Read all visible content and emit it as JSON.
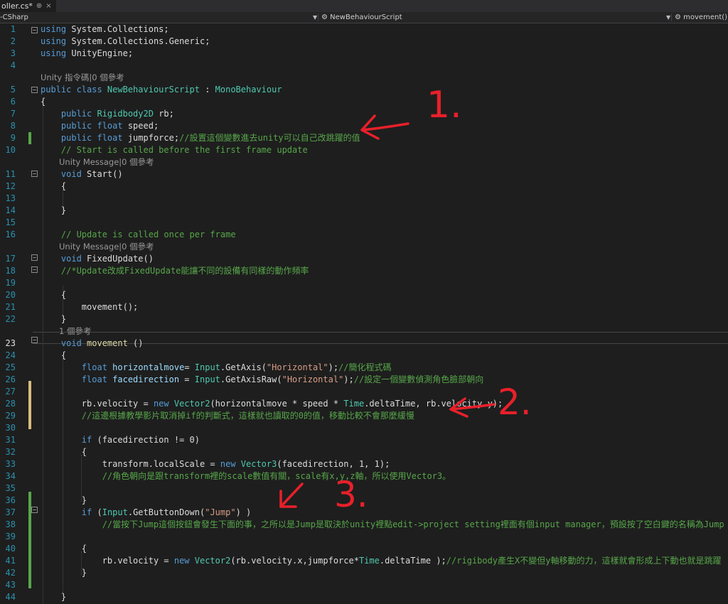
{
  "tab": {
    "label": "oller.cs*",
    "pin": "⊕",
    "close": "×"
  },
  "nav": {
    "project": "-CSharp",
    "class_icon": "⚙",
    "class": "NewBehaviourScript",
    "member_icon": "⚙",
    "member": "movement()"
  },
  "colors": {
    "background": "#1e1e1e",
    "keyword": "#569cd6",
    "type": "#4ec9b0",
    "comment": "#57a64a",
    "string": "#d69d85",
    "line_number": "#2b91af",
    "change_saved": "#57a64a",
    "change_unsaved": "#d7ba7d",
    "annotation": "#e8202a"
  },
  "lines": [
    {
      "n": "1",
      "parts": [
        {
          "c": "kw",
          "t": "using "
        },
        {
          "c": "",
          "t": "System.Collections;"
        }
      ]
    },
    {
      "n": "2",
      "parts": [
        {
          "c": "kw",
          "t": "using "
        },
        {
          "c": "",
          "t": "System.Collections.Generic;"
        }
      ]
    },
    {
      "n": "3",
      "parts": [
        {
          "c": "kw",
          "t": "using "
        },
        {
          "c": "",
          "t": "UnityEngine;"
        }
      ]
    },
    {
      "n": "4",
      "parts": []
    },
    {
      "lens": "Unity 指令碼|0 個參考"
    },
    {
      "n": "5",
      "parts": [
        {
          "c": "kw",
          "t": "public class "
        },
        {
          "c": "ty",
          "t": "NewBehaviourScript"
        },
        {
          "c": "",
          "t": " : "
        },
        {
          "c": "ty",
          "t": "MonoBehaviour"
        }
      ]
    },
    {
      "n": "6",
      "parts": [
        {
          "c": "",
          "t": "{"
        }
      ]
    },
    {
      "n": "7",
      "parts": [
        {
          "c": "",
          "t": "    "
        },
        {
          "c": "kw",
          "t": "public "
        },
        {
          "c": "ty",
          "t": "Rigidbody2D"
        },
        {
          "c": "",
          "t": " rb;"
        }
      ]
    },
    {
      "n": "8",
      "parts": [
        {
          "c": "",
          "t": "    "
        },
        {
          "c": "kw",
          "t": "public float "
        },
        {
          "c": "",
          "t": "speed;"
        }
      ]
    },
    {
      "n": "9",
      "parts": [
        {
          "c": "",
          "t": "    "
        },
        {
          "c": "kw",
          "t": "public float "
        },
        {
          "c": "",
          "t": "jumpforce;"
        },
        {
          "c": "cm",
          "t": "//設置這個變數進去unity可以自己改跳躍的值"
        }
      ]
    },
    {
      "n": "10",
      "parts": [
        {
          "c": "",
          "t": "    "
        },
        {
          "c": "cm",
          "t": "// Start is called before the first frame update"
        }
      ]
    },
    {
      "lens": "Unity Message|0 個參考"
    },
    {
      "n": "11",
      "parts": [
        {
          "c": "",
          "t": "    "
        },
        {
          "c": "kw",
          "t": "void "
        },
        {
          "c": "",
          "t": "Start()"
        }
      ]
    },
    {
      "n": "12",
      "parts": [
        {
          "c": "",
          "t": "    {"
        }
      ]
    },
    {
      "n": "13",
      "parts": []
    },
    {
      "n": "14",
      "parts": [
        {
          "c": "",
          "t": "    }"
        }
      ]
    },
    {
      "n": "15",
      "parts": []
    },
    {
      "n": "16",
      "parts": [
        {
          "c": "",
          "t": "    "
        },
        {
          "c": "cm",
          "t": "// Update is called once per frame"
        }
      ]
    },
    {
      "lens": "Unity Message|0 個參考"
    },
    {
      "n": "17",
      "parts": [
        {
          "c": "",
          "t": "    "
        },
        {
          "c": "kw",
          "t": "void "
        },
        {
          "c": "",
          "t": "FixedUpdate()"
        }
      ]
    },
    {
      "n": "18",
      "parts": [
        {
          "c": "",
          "t": "    "
        },
        {
          "c": "cm",
          "t": "//*Update改成FixedUpdate能讓不同的設備有同樣的動作頻率"
        }
      ]
    },
    {
      "n": "19",
      "parts": []
    },
    {
      "n": "20",
      "parts": [
        {
          "c": "",
          "t": "    {"
        }
      ]
    },
    {
      "n": "21",
      "parts": [
        {
          "c": "",
          "t": "        movement();"
        }
      ]
    },
    {
      "n": "22",
      "parts": [
        {
          "c": "",
          "t": "    }"
        }
      ]
    },
    {
      "lens": "1 個參考"
    },
    {
      "n": "23",
      "parts": [
        {
          "c": "",
          "t": "    "
        },
        {
          "c": "kw",
          "t": "void "
        },
        {
          "c": "fn",
          "t": "movement"
        },
        {
          "c": "",
          "t": " ()"
        }
      ]
    },
    {
      "n": "24",
      "parts": [
        {
          "c": "",
          "t": "    {"
        }
      ]
    },
    {
      "n": "25",
      "parts": [
        {
          "c": "",
          "t": "        "
        },
        {
          "c": "kw",
          "t": "float "
        },
        {
          "c": "id",
          "t": "horizontalmove"
        },
        {
          "c": "",
          "t": "= "
        },
        {
          "c": "ty",
          "t": "Input"
        },
        {
          "c": "",
          "t": ".GetAxis("
        },
        {
          "c": "st",
          "t": "\"Horizontal\""
        },
        {
          "c": "",
          "t": ");"
        },
        {
          "c": "cm",
          "t": "//簡化程式碼"
        }
      ]
    },
    {
      "n": "26",
      "parts": [
        {
          "c": "",
          "t": "        "
        },
        {
          "c": "kw",
          "t": "float "
        },
        {
          "c": "id",
          "t": "facedirection"
        },
        {
          "c": "",
          "t": " = "
        },
        {
          "c": "ty",
          "t": "Input"
        },
        {
          "c": "",
          "t": ".GetAxisRaw("
        },
        {
          "c": "st",
          "t": "\"Horizontal\""
        },
        {
          "c": "",
          "t": ");"
        },
        {
          "c": "cm",
          "t": "//設定一個變數偵測角色臉部朝向"
        }
      ]
    },
    {
      "n": "27",
      "parts": []
    },
    {
      "n": "28",
      "parts": [
        {
          "c": "",
          "t": "        rb.velocity = "
        },
        {
          "c": "kw",
          "t": "new "
        },
        {
          "c": "ty",
          "t": "Vector2"
        },
        {
          "c": "",
          "t": "(horizontalmove * speed * "
        },
        {
          "c": "ty",
          "t": "Time"
        },
        {
          "c": "",
          "t": ".deltaTime, rb.velocity.y);"
        }
      ]
    },
    {
      "n": "29",
      "parts": [
        {
          "c": "",
          "t": "        "
        },
        {
          "c": "cm",
          "t": "//這邊根據教學影片取消掉if的判斷式，這樣就也讀取的0的值，移動比較不會那麼緩慢"
        }
      ]
    },
    {
      "n": "30",
      "parts": []
    },
    {
      "n": "31",
      "parts": [
        {
          "c": "",
          "t": "        "
        },
        {
          "c": "kw",
          "t": "if "
        },
        {
          "c": "",
          "t": "(facedirection != 0)"
        }
      ]
    },
    {
      "n": "32",
      "parts": [
        {
          "c": "",
          "t": "        {"
        }
      ]
    },
    {
      "n": "33",
      "parts": [
        {
          "c": "",
          "t": "            transform.localScale = "
        },
        {
          "c": "kw",
          "t": "new "
        },
        {
          "c": "ty",
          "t": "Vector3"
        },
        {
          "c": "",
          "t": "(facedirection, 1, 1);"
        }
      ]
    },
    {
      "n": "34",
      "parts": [
        {
          "c": "",
          "t": "            "
        },
        {
          "c": "cm",
          "t": "//角色朝向是跟transform裡的scale數值有關，scale有x,y,z軸，所以使用Vector3。"
        }
      ]
    },
    {
      "n": "35",
      "parts": []
    },
    {
      "n": "36",
      "parts": [
        {
          "c": "",
          "t": "        }"
        }
      ]
    },
    {
      "n": "37",
      "parts": [
        {
          "c": "",
          "t": "        "
        },
        {
          "c": "kw",
          "t": "if "
        },
        {
          "c": "",
          "t": "("
        },
        {
          "c": "ty",
          "t": "Input"
        },
        {
          "c": "",
          "t": ".GetButtonDown("
        },
        {
          "c": "st",
          "t": "\"Jump\""
        },
        {
          "c": "",
          "t": ") )"
        }
      ]
    },
    {
      "n": "38",
      "parts": [
        {
          "c": "",
          "t": "            "
        },
        {
          "c": "cm",
          "t": "//當按下Jump這個按鈕會發生下面的事，之所以是Jump是取決於unity裡點edit->project setting裡面有個input manager，預設按了空白鍵的名稱為Jump"
        }
      ]
    },
    {
      "n": "39",
      "parts": []
    },
    {
      "n": "40",
      "parts": [
        {
          "c": "",
          "t": "        {"
        }
      ]
    },
    {
      "n": "41",
      "parts": [
        {
          "c": "",
          "t": "            rb.velocity = "
        },
        {
          "c": "kw",
          "t": "new "
        },
        {
          "c": "ty",
          "t": "Vector2"
        },
        {
          "c": "",
          "t": "(rb.velocity.x,jumpforce*"
        },
        {
          "c": "ty",
          "t": "Time"
        },
        {
          "c": "",
          "t": ".deltaTime );"
        },
        {
          "c": "cm",
          "t": "//rigibody產生X不變但y軸移動的力，這樣就會形成上下動也就是跳躍"
        }
      ]
    },
    {
      "n": "42",
      "parts": [
        {
          "c": "",
          "t": "        }"
        }
      ]
    },
    {
      "n": "43",
      "parts": []
    },
    {
      "n": "44",
      "parts": [
        {
          "c": "",
          "t": "    }"
        }
      ]
    }
  ],
  "annotations": [
    "1.",
    "2.",
    "3."
  ]
}
